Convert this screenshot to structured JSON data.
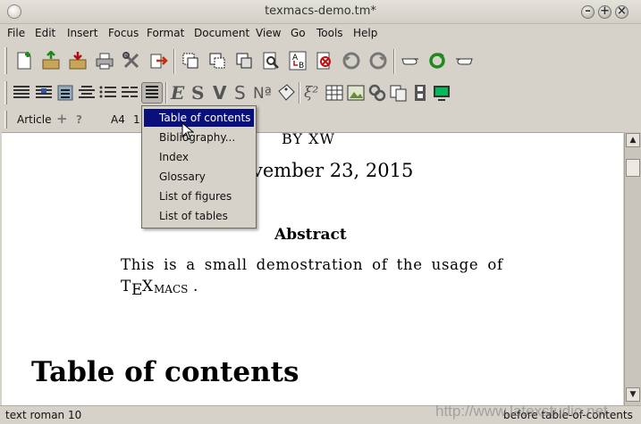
{
  "window": {
    "title": "texmacs-demo.tm*"
  },
  "menubar": [
    "File",
    "Edit",
    "Insert",
    "Focus",
    "Format",
    "Document",
    "View",
    "Go",
    "Tools",
    "Help"
  ],
  "modebar": {
    "style": "Article",
    "plus": "+",
    "help": "?",
    "paper": "A4",
    "size": "1"
  },
  "dropdown": {
    "items": [
      "Table of contents",
      "Bibliography...",
      "Index",
      "Glossary",
      "List of figures",
      "List of tables"
    ],
    "selected": "Table of contents"
  },
  "document": {
    "author": "BY XW",
    "date": "vember 23, 2015",
    "abstract_title": "Abstract",
    "abstract_line1": "This is a small demostration of the usage of",
    "abstract_suffix": ".",
    "logo_t": "T",
    "logo_e": "E",
    "logo_x": "X",
    "logo_macs": "MACS",
    "section_title": "Table of contents"
  },
  "statusbar": {
    "left": "text roman 10",
    "right": "before table-of-contents"
  },
  "watermark": "http://www.latexstudio.net",
  "colors": {
    "menu_highlight": "#0a107a",
    "chrome": "#d6d2ca"
  }
}
